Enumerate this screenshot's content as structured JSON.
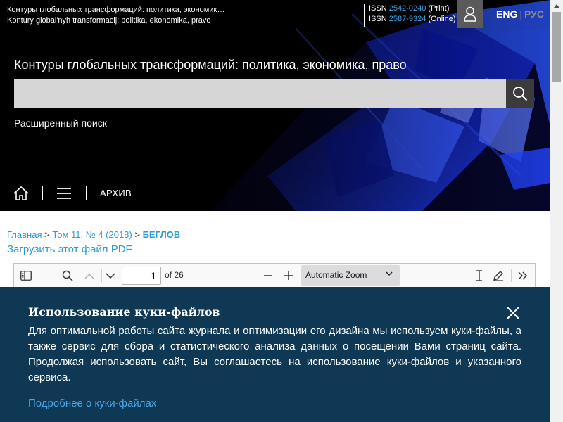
{
  "header": {
    "journal_name_ru": "Контуры глобальных трансформаций: политика, экономика, право",
    "journal_name_translit": "Kontury global'nyh transformacij: politika, ekonomika, pravo",
    "issn_label": "ISSN",
    "issn_print": "2542-0240",
    "issn_print_label": "(Print)",
    "issn_online": "2587-9324",
    "issn_online_label": "(Online)",
    "lang_active": "ENG",
    "lang_sep": "|",
    "lang_inactive": "РУС",
    "site_title": "Контуры глобальных трансформаций: политика, экономика, право",
    "search_value": "",
    "advanced_search": "Расширенный поиск"
  },
  "nav": {
    "archive": "АРХИВ"
  },
  "breadcrumb": {
    "home": "Главная",
    "sep": ">",
    "issue": "Том 11, № 4 (2018)",
    "current": "БЕГЛОВ"
  },
  "download_label": "Загрузить этот файл PDF",
  "pdf_toolbar": {
    "page_number": "1",
    "page_total": "of 26",
    "zoom_value": "Automatic Zoom"
  },
  "cookie": {
    "title": "Использование куки-файлов",
    "text": "Для оптимальной работы сайта журнала и оптимизации его дизайна мы используем куки-файлы, а также сервис для сбора и статистического анализа данных о посещении Вами страниц сайта. Продолжая использовать сайт, Вы соглашаетесь на использование куки-файлов и указанного сервиса.",
    "more": "Подробнее о куки-файлах"
  },
  "colors": {
    "link": "#2e9ad6",
    "cookie_bg": "#0f3854",
    "header_bg": "#000000",
    "accent_blue": "#1a3cff"
  },
  "icons": [
    "user-icon",
    "search-icon",
    "home-icon",
    "menu-icon",
    "sidebar-toggle-icon",
    "find-icon",
    "chevron-up-icon",
    "chevron-down-icon",
    "zoom-out-icon",
    "zoom-in-icon",
    "text-cursor-icon",
    "draw-icon",
    "more-tools-icon",
    "close-icon"
  ]
}
